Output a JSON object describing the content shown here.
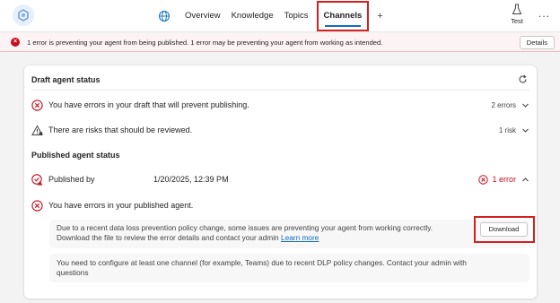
{
  "topbar": {
    "tabs": [
      "Overview",
      "Knowledge",
      "Topics",
      "Channels"
    ],
    "active_tab": "Channels",
    "add_label": "+",
    "test_label": "Test",
    "more_label": "..."
  },
  "banner": {
    "message": "1 error is preventing your agent from being published. 1 error may be preventing your agent from working as intended.",
    "details_label": "Details"
  },
  "draft": {
    "title": "Draft agent status",
    "errors_text": "You have errors in your draft that will prevent publishing.",
    "errors_count": "2 errors",
    "risks_text": "There are risks that should be reviewed.",
    "risks_count": "1 risk"
  },
  "published": {
    "title": "Published agent status",
    "published_by_label": "Published by",
    "published_date": "1/20/2025, 12:39 PM",
    "error_count": "1 error",
    "errors_text": "You have errors in your published agent.",
    "notice1_line1": "Due to a recent data loss prevention policy change, some issues are preventing your agent from working correctly.",
    "notice1_line2": "Download the file to review the error details and contact your admin",
    "learn_more": "Learn more",
    "download_label": "Download",
    "notice2_line1": "You need to configure at least one channel (for example, Teams) due to recent DLP policy changes. Contact your admin with",
    "notice2_line2": "questions"
  },
  "colors": {
    "error": "#c50f1f",
    "accent": "#0f6cbd",
    "highlight_box": "#d42020"
  },
  "icons": [
    "agent-logo-icon",
    "globe-icon",
    "flask-icon",
    "more-icon",
    "error-icon",
    "refresh-icon",
    "chevron-down-icon",
    "chevron-up-icon",
    "warning-icon",
    "published-error-icon"
  ]
}
